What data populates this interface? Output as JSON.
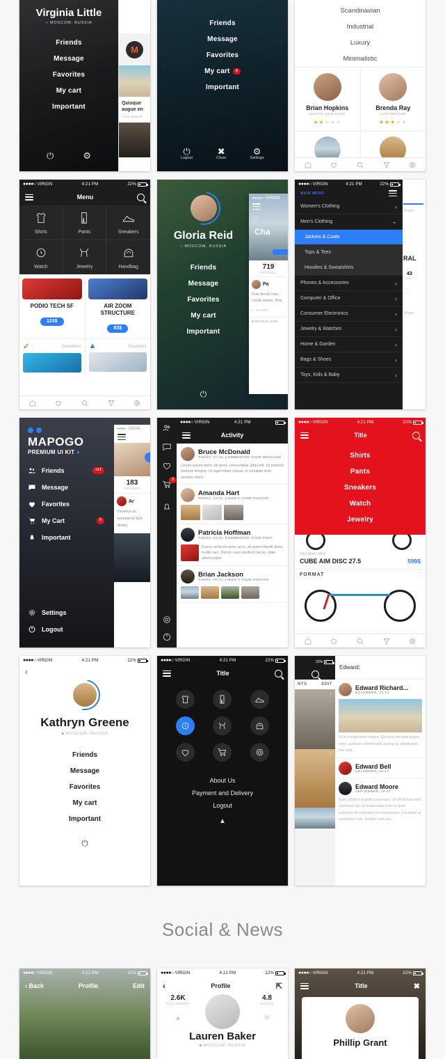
{
  "section": {
    "heading": "Social & News"
  },
  "status": {
    "carrier": "VIRGIN",
    "time": "4:21 PM",
    "battery": "22%",
    "dots": "●●●●○"
  },
  "cards": {
    "virginia": {
      "name": "Virginia Little",
      "location": "MOSCOW, RUSSIA",
      "menu": [
        "Friends",
        "Message",
        "Favorites",
        "My cart",
        "Important"
      ],
      "footer": [
        "power-icon",
        "gear-icon"
      ],
      "peek": {
        "headline": "Quisque augue en",
        "sub": "Cras quis re",
        "logo": "M"
      }
    },
    "night_menu": {
      "menu": [
        "Friends",
        "Message",
        "Favorites",
        "My cart",
        "Important"
      ],
      "cart_badge": "3",
      "footer": [
        {
          "label": "Logout",
          "icon": "power-icon"
        },
        {
          "label": "Close",
          "icon": "close-icon"
        },
        {
          "label": "Settings",
          "icon": "gear-icon"
        }
      ]
    },
    "styles": {
      "items": [
        "Scandinavian",
        "Industrial",
        "Luxury",
        "Minimalistic"
      ],
      "people": [
        {
          "name": "Brian Hopkins",
          "role": "DIGITAL DESIGNER",
          "stars": 2
        },
        {
          "name": "Brenda Ray",
          "role": "COPYWRITER",
          "stars": 3
        }
      ]
    },
    "menu_grid": {
      "title": "Menu",
      "tiles": [
        "Shirts",
        "Pants",
        "Sneakers",
        "Watch",
        "Jewelry",
        "Handbag"
      ],
      "products": [
        {
          "name": "PODIO TECH SF",
          "price": "124$"
        },
        {
          "name": "AIR ZOOM STRUCTURE",
          "price": "83$"
        }
      ],
      "brand_rows": [
        {
          "brand": "nike-logo",
          "cat": "Sneakers"
        },
        {
          "brand": "adidas-logo",
          "cat": "Sneakers"
        }
      ]
    },
    "gloria": {
      "name": "Gloria Reid",
      "location": "MOSCOW, RUSSIA",
      "menu": [
        "Friends",
        "Message",
        "Favorites",
        "My cart",
        "Important"
      ],
      "peek": {
        "title": "Cha",
        "count": "719",
        "count_label": "FRIENDS",
        "post_name": "Pa",
        "post_body": "Duis tincidi ham condi ornare. Pha",
        "share": "SHARE",
        "likes": "PEOPLE LIKES"
      }
    },
    "catalog": {
      "header": "MAIN MENU",
      "rows": [
        {
          "label": "Women's Clothing",
          "type": "chevron"
        },
        {
          "label": "Men's Clothing",
          "type": "expanded"
        },
        {
          "label": "Jackets & Coats",
          "type": "selected"
        },
        {
          "label": "Tops & Tees",
          "type": "sub"
        },
        {
          "label": "Hoodies & Sweatshirts",
          "type": "sub"
        },
        {
          "label": "Phones & Accessories",
          "type": "chevron"
        },
        {
          "label": "Computer & Office",
          "type": "chevron"
        },
        {
          "label": "Consumer Electronics",
          "type": "chevron"
        },
        {
          "label": "Jewelry & Watches",
          "type": "chevron"
        },
        {
          "label": "Home & Garden",
          "type": "chevron"
        },
        {
          "label": "Bags & Shoes",
          "type": "chevron"
        },
        {
          "label": "Toys, Kids & Baby",
          "type": "chevron"
        }
      ],
      "peek": {
        "cat": "Shoes",
        "brand": "RAL",
        "price": "43"
      }
    },
    "mapogo": {
      "brand": "MAPOGO",
      "tagline": "PREMIUM UI KIT",
      "items": [
        {
          "label": "Friends",
          "icon": "people-icon",
          "badge": "+17"
        },
        {
          "label": "Message",
          "icon": "chat-icon",
          "badge": ""
        },
        {
          "label": "Favorites",
          "icon": "heart-icon",
          "badge": ""
        },
        {
          "label": "My Cart",
          "icon": "cart-icon",
          "badge": "5"
        },
        {
          "label": "Important",
          "icon": "bell-icon",
          "badge": ""
        }
      ],
      "bottom": [
        {
          "label": "Settings",
          "icon": "gear-icon"
        },
        {
          "label": "Logout",
          "icon": "power-icon"
        }
      ],
      "peek": {
        "count": "183",
        "count_label": "FRIENDS",
        "name": "Ar",
        "body": "Vivamus ac volutpat al Sed ullamc"
      }
    },
    "activity": {
      "title": "Activity",
      "rail_badge": "3",
      "rail_icons": [
        "people-icon",
        "chat-icon",
        "heart-icon",
        "cart-icon",
        "bell-icon",
        "gear-icon",
        "power-icon"
      ],
      "items": [
        {
          "name": "Bruce McDonald",
          "meta": "TODAY, 17:24. COMMENTED YOUR MESSAGE",
          "body": "Lorem ipsum dolor sit amet, consectetur adipi elit. Ut pretium pretium tempor. Ut eget imper neque. In volutpat ante semper diam.",
          "photos": 0
        },
        {
          "name": "Amanda Hart",
          "meta": "TODAY, 13:01. LIKED 3 YOUR PHOTOS",
          "body": "",
          "photos": 3
        },
        {
          "name": "Patricia Hoffman",
          "meta": "TODAY, 10:41. COMMENTED YOUR POST",
          "body": "Fusce vehicula dolor arcu, sit amet blandit dolor mollis nec. Donec viver eleifend lacus, vitae ullamcorper.",
          "photos": 1
        },
        {
          "name": "Brian Jackson",
          "meta": "TODAY, 09:27. LIKED 5 YOUR PHOTOS",
          "body": "",
          "photos": 4
        }
      ]
    },
    "red_menu": {
      "title": "Title",
      "menu": [
        "Shirts",
        "Pants",
        "Sneakers",
        "Watch",
        "Jewelry"
      ],
      "accent": "#e4121c",
      "product": {
        "cat": "Mountain bike",
        "name": "CUBE AIM DISC 27.5",
        "price": "599$"
      },
      "second_brand": "FORMAT"
    },
    "kathryn": {
      "name": "Kathryn Greene",
      "location": "MOSCOW, RUSSIA",
      "menu": [
        "Friends",
        "Message",
        "Favorites",
        "My cart",
        "Important"
      ],
      "back": "back-icon",
      "footer_icon": "power-icon"
    },
    "dark_grid": {
      "title": "Title",
      "icons": [
        "shirt-icon",
        "pants-icon",
        "sneaker-icon",
        "watch-icon",
        "jewelry-icon",
        "handbag-icon",
        "heart-icon",
        "cart-icon",
        "gear-icon"
      ],
      "active_index": 3,
      "links": [
        "About Us",
        "Payment and Delivery",
        "Logout"
      ],
      "collapse": "chevron-up-icon"
    },
    "search": {
      "query": "Edward",
      "left_tabs": [
        "NTS",
        "EDIT"
      ],
      "results": [
        {
          "name": "Edward Richard...",
          "meta": "NOVEMBER, 23:03",
          "body": "Ut id consectetur magna. Quisque volutpat augue enim, pulvinar lobortis nibh lacinia at. Vestibulum nec erat.",
          "photo": true
        },
        {
          "name": "Edward Bell",
          "meta": "DECEMBER, 05:17",
          "body": "",
          "photo": false
        },
        {
          "name": "Edward Moore",
          "meta": "SEPTEMBER, 16:47",
          "body": "Nam porttitor blandit accumsan. Ut vel dictum sem, a pretium dui. In malesuada enim in dolor euismod, id commodo mi consectetur. Curabitur at vestibulum nisi. Nullam vehicula.",
          "photo": false
        }
      ]
    },
    "profile_forest": {
      "back": "Back",
      "title": "Profile",
      "edit": "Edit"
    },
    "profile_lauren": {
      "title": "Profile",
      "name": "Lauren Baker",
      "location": "MOSCOW, RUSSIA",
      "stats": [
        {
          "value": "2.6K",
          "label": "FOLLOWERS"
        },
        {
          "value": "4.8",
          "label": "RATING"
        }
      ],
      "actions": [
        "add-icon",
        "chat-icon"
      ],
      "share": "share-icon"
    },
    "phillip": {
      "title": "Title",
      "name": "Phillip Grant",
      "close": "close-icon"
    }
  }
}
